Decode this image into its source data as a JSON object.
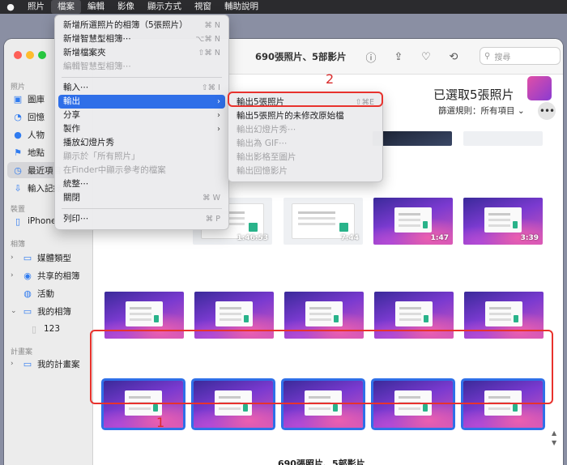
{
  "menubar": {
    "apple": "",
    "items": [
      "照片",
      "檔案",
      "編輯",
      "影像",
      "顯示方式",
      "視窗",
      "輔助說明"
    ]
  },
  "sidebar": {
    "section_photos": "照片",
    "photos_items": [
      {
        "label": "圖庫",
        "icon": "photo-library-icon"
      },
      {
        "label": "回憶",
        "icon": "memories-icon"
      },
      {
        "label": "人物",
        "icon": "people-icon"
      },
      {
        "label": "地點",
        "icon": "places-icon"
      },
      {
        "label": "最近項目",
        "icon": "recents-icon"
      },
      {
        "label": "輸入記錄",
        "icon": "imports-icon"
      }
    ],
    "section_devices": "裝置",
    "devices_items": [
      {
        "label": "iPhone",
        "icon": "iphone-icon"
      }
    ],
    "section_albums": "相簿",
    "albums_items": [
      {
        "label": "媒體類型",
        "icon": "folder-icon"
      },
      {
        "label": "共享的相簿",
        "icon": "shared-albums-icon"
      },
      {
        "label": "活動",
        "icon": "activity-icon"
      },
      {
        "label": "我的相簿",
        "icon": "folder-icon"
      },
      {
        "label": "123",
        "icon": "album-thumb-icon"
      }
    ],
    "section_projects": "計畫案",
    "projects_items": [
      {
        "label": "我的計畫案",
        "icon": "folder-icon"
      }
    ]
  },
  "toolbar": {
    "title": "690張照片、5部影片",
    "search_placeholder": "搜尋"
  },
  "content": {
    "selection_title": "已選取5張照片",
    "filter_label": "篩選規則：所有項目",
    "grid_footer": "690張照片、5部影片",
    "durations": [
      "1:46:53",
      "7:44",
      "1:47",
      "3:39"
    ]
  },
  "annotations": {
    "label_1": "1",
    "label_2": "2"
  },
  "file_menu": {
    "items": [
      {
        "label": "新增所選照片的相簿（5張照片）",
        "shortcut": "⌘ N",
        "disabled": false
      },
      {
        "label": "新增智慧型相簿⋯",
        "shortcut": "⌥⌘ N",
        "disabled": false
      },
      {
        "label": "新增檔案夾",
        "shortcut": "⇧⌘ N",
        "disabled": false
      },
      {
        "label": "編輯智慧型相簿⋯",
        "shortcut": "",
        "disabled": true
      },
      {
        "label": "輸入⋯",
        "shortcut": "⇧⌘ I",
        "disabled": false
      },
      {
        "label": "輸出",
        "shortcut": "",
        "disabled": false,
        "submenu": true
      },
      {
        "label": "分享",
        "shortcut": "",
        "disabled": false,
        "submenu": true
      },
      {
        "label": "製作",
        "shortcut": "",
        "disabled": false,
        "submenu": true
      },
      {
        "label": "播放幻燈片秀",
        "shortcut": "",
        "disabled": false
      },
      {
        "label": "顯示於「所有照片」",
        "shortcut": "",
        "disabled": true
      },
      {
        "label": "在Finder中顯示參考的檔案",
        "shortcut": "",
        "disabled": true
      },
      {
        "label": "統整⋯",
        "shortcut": "",
        "disabled": false
      },
      {
        "label": "關閉",
        "shortcut": "⌘ W",
        "disabled": false
      },
      {
        "label": "列印⋯",
        "shortcut": "⌘ P",
        "disabled": false
      }
    ]
  },
  "export_submenu": {
    "items": [
      {
        "label": "輸出5張照片",
        "shortcut": "⇧⌘E",
        "disabled": false
      },
      {
        "label": "輸出5張照片的未修改原始檔",
        "shortcut": "",
        "disabled": false
      },
      {
        "label": "輸出幻燈片秀⋯",
        "shortcut": "",
        "disabled": true
      },
      {
        "label": "輸出為 GIF⋯",
        "shortcut": "",
        "disabled": true
      },
      {
        "label": "輸出影格至圖片",
        "shortcut": "",
        "disabled": true
      },
      {
        "label": "輸出回憶影片",
        "shortcut": "",
        "disabled": true
      }
    ]
  },
  "colors": {
    "accent": "#2f6fe8",
    "annotation_red": "#e8322d",
    "traffic_red": "#fe5f57",
    "traffic_yellow": "#febc2e",
    "traffic_green": "#28c840"
  }
}
